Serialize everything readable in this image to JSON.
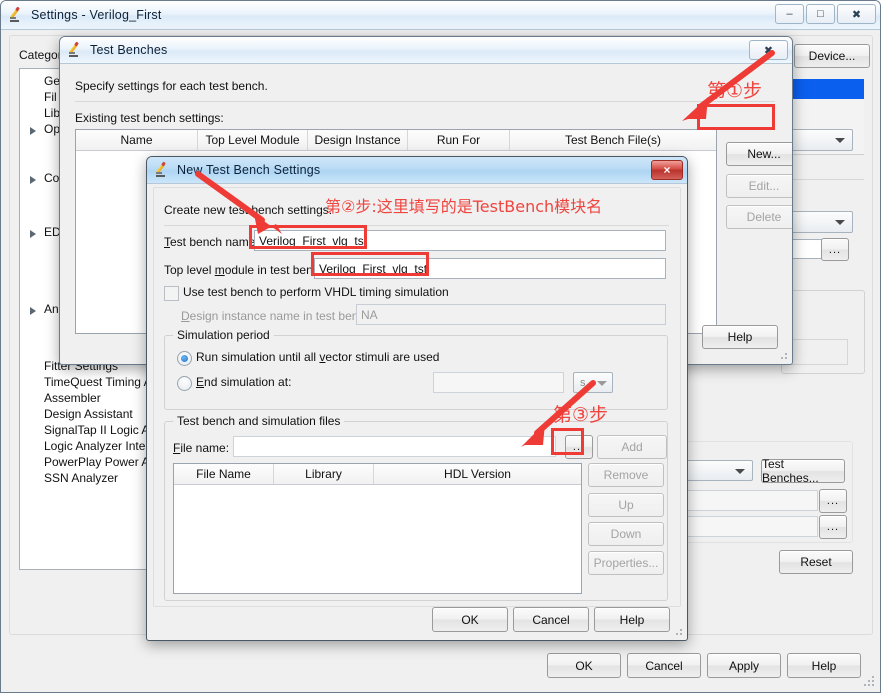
{
  "main_window": {
    "title": "Settings - Verilog_First",
    "icon": "pencil-icon",
    "minimize": "–",
    "maximize": "□",
    "close": "✖",
    "category_label": "Category:",
    "tree_top": [
      {
        "label": "Ge",
        "expander": false
      },
      {
        "label": "Fil",
        "expander": false
      },
      {
        "label": "Lib",
        "expander": false
      },
      {
        "label": "Op",
        "expander": true
      },
      {
        "label": "Co",
        "expander": true
      },
      {
        "label": "ED",
        "expander": true
      },
      {
        "label": "An",
        "expander": true
      }
    ],
    "tree_bottom": [
      "Fitter Settings",
      "TimeQuest Timing An",
      "Assembler",
      "Design Assistant",
      "SignalTap II Logic An",
      "Logic Analyzer Interf",
      "PowerPlay Power An",
      "SSN Analyzer"
    ],
    "device_button": "Device...",
    "test_benches_button": "Test Benches...",
    "reset_button": "Reset",
    "browse_button": "...",
    "footer": {
      "ok": "OK",
      "cancel": "Cancel",
      "apply": "Apply",
      "help": "Help"
    }
  },
  "test_benches_dialog": {
    "title": "Test Benches",
    "icon": "pencil-icon",
    "close": "✖",
    "description": "Specify settings for each test bench.",
    "list_label": "Existing test bench settings:",
    "columns": [
      "Name",
      "Top Level Module",
      "Design Instance",
      "Run For",
      "Test Bench File(s)"
    ],
    "rows": [],
    "buttons": {
      "new": "New...",
      "edit": "Edit...",
      "delete": "Delete",
      "help": "Help"
    }
  },
  "new_test_bench_dialog": {
    "title": "New Test Bench Settings",
    "icon": "pencil-icon",
    "close": "✖",
    "description": "Create new test bench settings.",
    "test_bench_name": {
      "label": "Test bench name:",
      "value": "Verilog_First_vlg_tst"
    },
    "top_level_module": {
      "label": "Top level module in test bench:",
      "value": "Verilog_First_vlg_tst"
    },
    "vhdl_checkbox": {
      "label": "Use test bench to perform VHDL timing simulation",
      "checked": false
    },
    "design_instance": {
      "label": "Design instance name in test bench:",
      "value": "NA"
    },
    "simulation_period": {
      "title": "Simulation period",
      "option_run_all": "Run simulation until all vector stimuli are used",
      "option_end_at": "End simulation at:",
      "end_value": "",
      "unit": "s",
      "selected": "run_all"
    },
    "files_group": {
      "title": "Test bench and simulation files",
      "file_name_label": "File name:",
      "file_name_value": "",
      "browse_button": "...",
      "add_button": "Add",
      "columns": [
        "File Name",
        "Library",
        "HDL Version"
      ],
      "rows": [],
      "side_buttons": [
        "Remove",
        "Up",
        "Down",
        "Properties..."
      ]
    },
    "footer": {
      "ok": "OK",
      "cancel": "Cancel",
      "help": "Help"
    }
  },
  "annotations": {
    "color": "#f0453f",
    "step1": "第①步",
    "step2": "第②步:这里填写的是TestBench模块名",
    "step3": "第③步"
  },
  "theme": {
    "accent_blue": "#0b5fef",
    "dialog_bg": "#f0f0f0",
    "title_blue": "#bcdcf5"
  }
}
